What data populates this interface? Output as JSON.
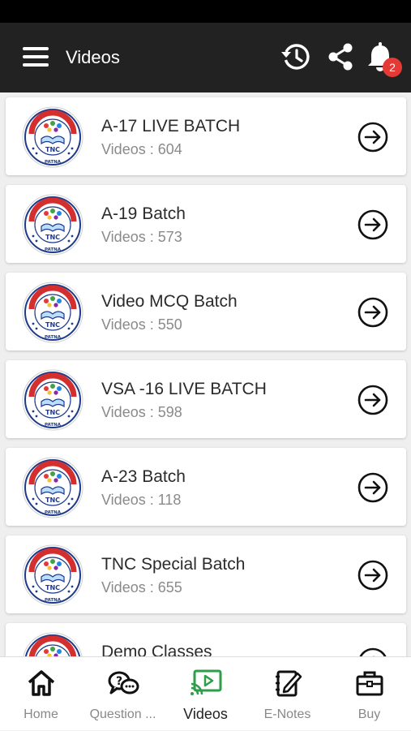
{
  "header": {
    "title": "Videos",
    "notification_count": "2",
    "icons": [
      "menu-icon",
      "history-icon",
      "share-icon",
      "bell-icon"
    ]
  },
  "batches": [
    {
      "name": "A-17 LIVE BATCH",
      "count": "Videos : 604"
    },
    {
      "name": "A-19 Batch",
      "count": "Videos : 573"
    },
    {
      "name": "Video MCQ Batch",
      "count": "Videos : 550"
    },
    {
      "name": "VSA -16 LIVE BATCH",
      "count": "Videos : 598"
    },
    {
      "name": "A-23 Batch",
      "count": "Videos : 118"
    },
    {
      "name": "TNC Special Batch",
      "count": "Videos : 655"
    },
    {
      "name": "Demo Classes",
      "count": ""
    }
  ],
  "logo": {
    "ring_text": "TEAM NURSING CLASSES",
    "center_text": "TNC",
    "bottom_text": "PATNA"
  },
  "nav": [
    {
      "label": "Home",
      "icon": "home-icon"
    },
    {
      "label": "Question ...",
      "icon": "question-chat-icon"
    },
    {
      "label": "Videos",
      "icon": "video-cast-icon",
      "active": true
    },
    {
      "label": "E-Notes",
      "icon": "notes-edit-icon"
    },
    {
      "label": "Buy",
      "icon": "briefcase-icon"
    }
  ],
  "colors": {
    "appbar": "#222222",
    "badge": "#e53935",
    "active_nav": "#2e9e4a",
    "logo_red": "#d32f2f",
    "logo_blue": "#1e3a8a"
  }
}
